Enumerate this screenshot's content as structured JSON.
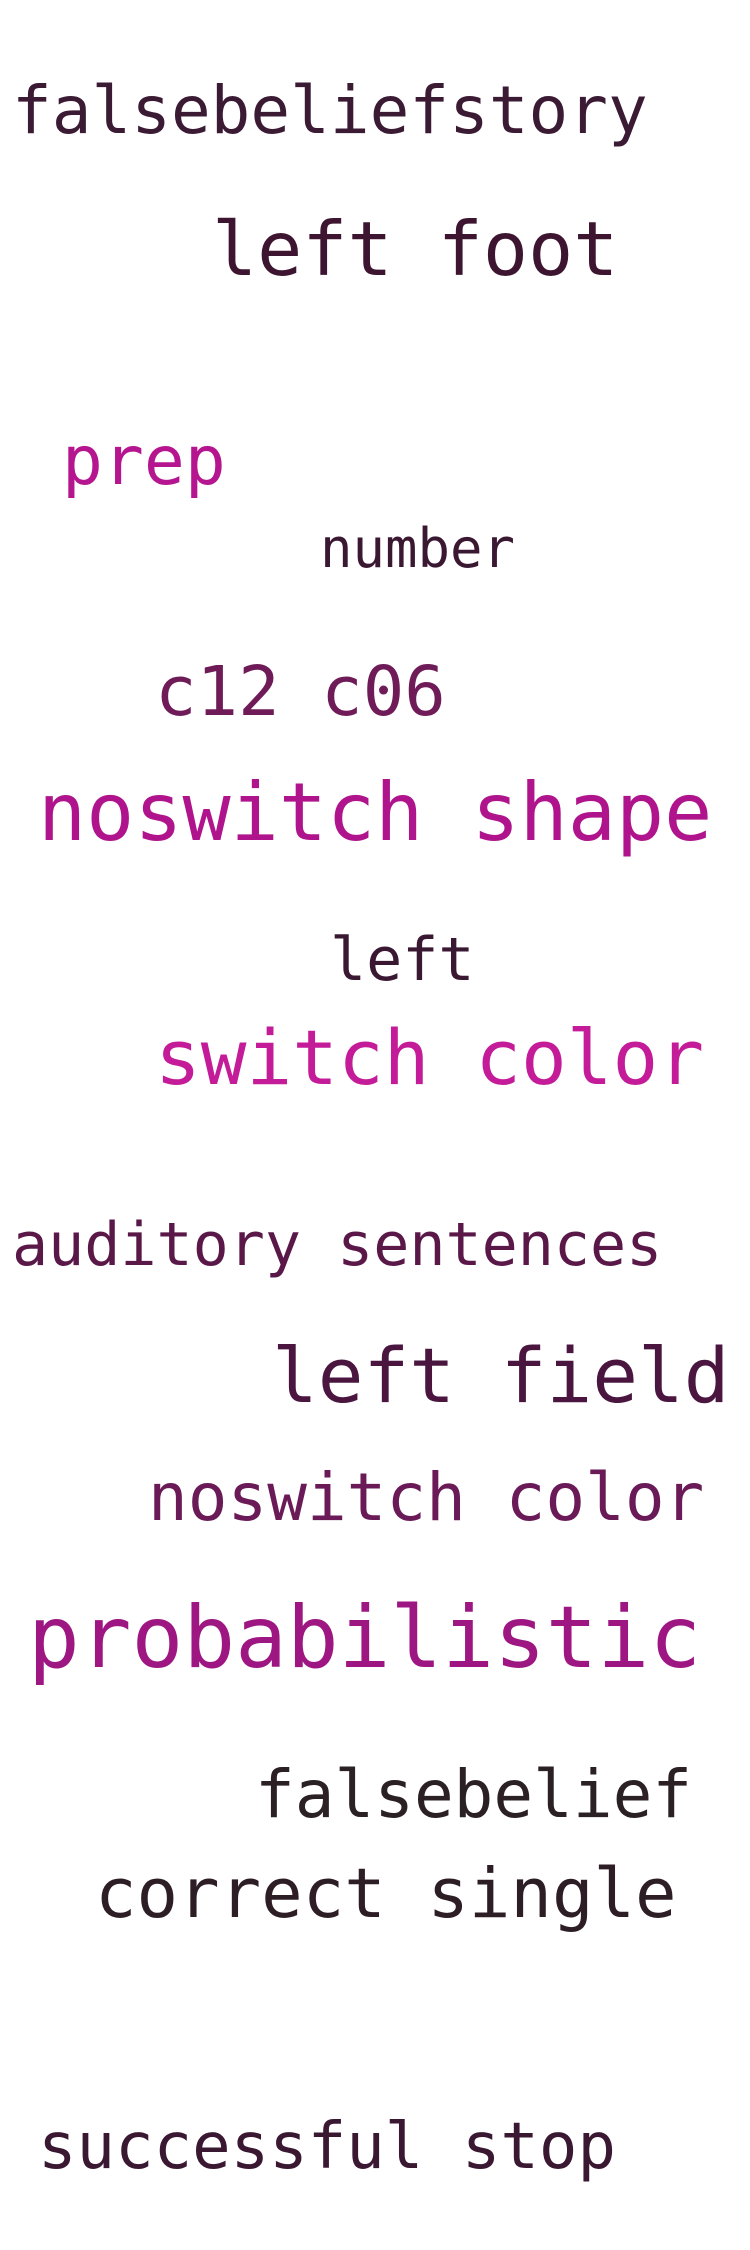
{
  "words": [
    {
      "text": "falsebeliefstory",
      "color": "#3b1a33"
    },
    {
      "text": "left foot",
      "color": "#3d1530"
    },
    {
      "text": "prep",
      "color": "#b5168f"
    },
    {
      "text": "number",
      "color": "#3a1832"
    },
    {
      "text": "c12 c06",
      "color": "#6e1b58"
    },
    {
      "text": "noswitch shape",
      "color": "#b0148c"
    },
    {
      "text": "left",
      "color": "#3a1832"
    },
    {
      "text": "switch color",
      "color": "#c41c98"
    },
    {
      "text": "auditory sentences",
      "color": "#5a1848"
    },
    {
      "text": "left field",
      "color": "#4a1640"
    },
    {
      "text": "noswitch color",
      "color": "#6a1a57"
    },
    {
      "text": "probabilistic",
      "color": "#9e1682"
    },
    {
      "text": "falsebelief",
      "color": "#2b2124"
    },
    {
      "text": "correct single",
      "color": "#2d1e26"
    },
    {
      "text": "successful stop",
      "color": "#3a1832"
    }
  ]
}
